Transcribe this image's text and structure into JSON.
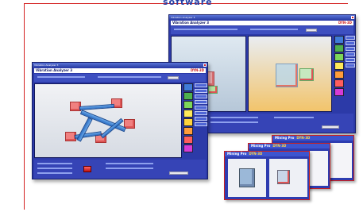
{
  "heading": "software",
  "front_window": {
    "title_bar": "Vibration Analyzer 3",
    "header_title": "Vibration Analyzer 3",
    "version": "DYN-3D"
  },
  "back_window": {
    "title_bar": "Vibration Analyzer 3",
    "header_title": "Vibration Analyzer 3",
    "version": "DYN-3D"
  },
  "thumbnails": [
    {
      "title": "Mining Pro",
      "version": "DYN-3D"
    },
    {
      "title": "Mining Pro",
      "version": "DYN-3D"
    },
    {
      "title": "Mining Pro",
      "version": "DYN-3D"
    }
  ],
  "colors": {
    "frame_border": "#d42222",
    "window_blue": "#2c3aa8",
    "view_bg": "#eceef3",
    "thumb_border": "#c92020"
  },
  "swatches": [
    "#3f7bd8",
    "#4fb14f",
    "#7dd65a",
    "#ffe95a",
    "#ffd23c",
    "#ff9c3a",
    "#ff5d5d",
    "#d63bd6",
    "#8f8f8f"
  ]
}
